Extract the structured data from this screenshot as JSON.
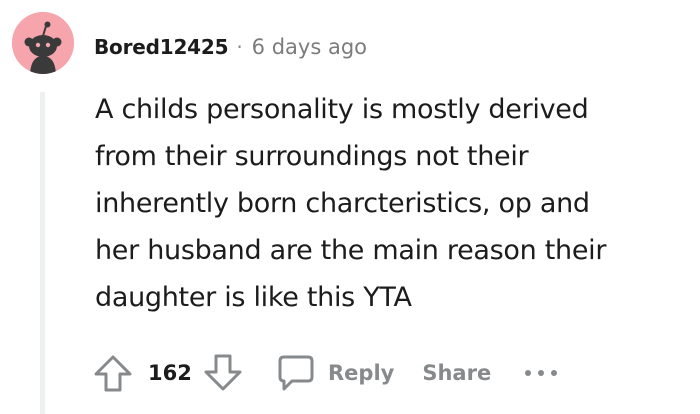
{
  "comment": {
    "author": "Bored12425",
    "separator": "·",
    "timestamp": "6 days ago",
    "body_lines": [
      "A childs personality is mostly derived",
      "from their surroundings not their",
      "inherently born charcteristics, op and",
      "her husband are the main reason their",
      "daughter is like this YTA"
    ],
    "score": "162",
    "reply_label": "Reply",
    "share_label": "Share",
    "more_label": "•••",
    "avatar_icon": "snoo-avatar-icon",
    "avatar_color": "#f7a5ad"
  },
  "colors": {
    "text": "#1c1c1c",
    "muted": "#878a8c",
    "thread_line": "#edeff1"
  }
}
